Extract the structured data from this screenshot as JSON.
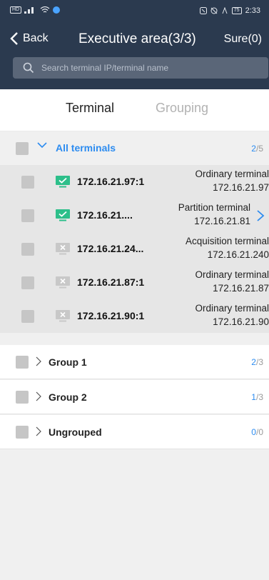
{
  "status_bar": {
    "time": "2:33",
    "battery": "75"
  },
  "nav": {
    "back_label": "Back",
    "title": "Executive area(3/3)",
    "sure_label": "Sure(0)"
  },
  "search": {
    "placeholder": "Search terminal IP/terminal name"
  },
  "tabs": [
    {
      "label": "Terminal",
      "active": true
    },
    {
      "label": "Grouping",
      "active": false
    }
  ],
  "all_terminals": {
    "label": "All terminals",
    "selected": "2",
    "total": "5"
  },
  "terminals": [
    {
      "ip": "172.16.21.97:1",
      "type": "Ordinary terminal",
      "address": "172.16.21.97",
      "online": true,
      "icon": "monitor-online-icon"
    },
    {
      "ip": "172.16.21....",
      "type": "Partition terminal",
      "address": "172.16.21.81",
      "online": true,
      "icon": "monitor-online-icon"
    },
    {
      "ip": "172.16.21.24...",
      "type": "Acquisition terminal",
      "address": "172.16.21.240",
      "online": false,
      "icon": "monitor-offline-icon"
    },
    {
      "ip": "172.16.21.87:1",
      "type": "Ordinary terminal",
      "address": "172.16.21.87",
      "online": false,
      "icon": "monitor-offline-icon"
    },
    {
      "ip": "172.16.21.90:1",
      "type": "Ordinary terminal",
      "address": "172.16.21.90",
      "online": false,
      "icon": "monitor-offline-icon"
    }
  ],
  "groups": [
    {
      "label": "Group 1",
      "selected": "2",
      "total": "3"
    },
    {
      "label": "Group 2",
      "selected": "1",
      "total": "3"
    },
    {
      "label": "Ungrouped",
      "selected": "0",
      "total": "0"
    }
  ],
  "colors": {
    "header_bg": "#2b3a4f",
    "accent": "#2d8cf0",
    "online": "#2dbf8a",
    "offline": "#c8c8c8"
  }
}
